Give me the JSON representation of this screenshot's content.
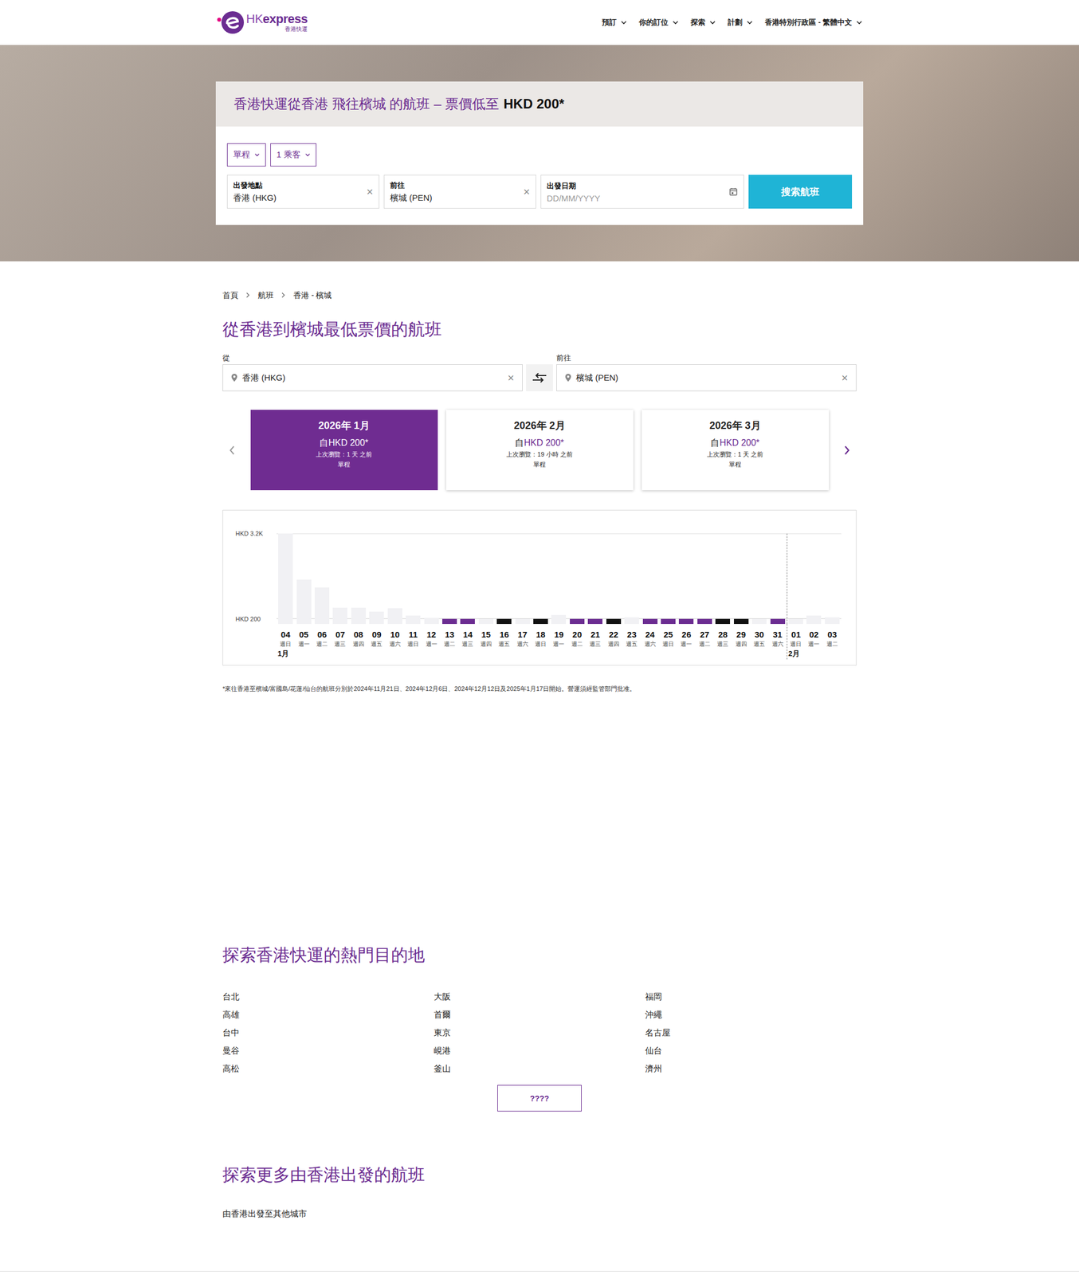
{
  "header": {
    "logo": {
      "prefix": "HK",
      "name": "express",
      "sub": "香港快運"
    },
    "nav": [
      {
        "label": "預訂"
      },
      {
        "label": "你的訂位"
      },
      {
        "label": "探索"
      },
      {
        "label": "計劃"
      },
      {
        "label": "香港特別行政區 - 繁體中文"
      }
    ]
  },
  "hero": {
    "title": "香港快運從香港 飛往檳城 的航班 – 票價低至",
    "title_price": "HKD 200*",
    "trip_type": "單程",
    "passengers": "1 乘客",
    "fields": [
      {
        "kind": "clearable",
        "label": "出發地點",
        "value": "香港 (HKG)",
        "clear": "×"
      },
      {
        "kind": "clearable",
        "label": "前往",
        "value": "檳城 (PEN)",
        "clear": "×"
      },
      {
        "kind": "date",
        "label": "出發日期",
        "placeholder": "DD/MM/YYYY"
      }
    ],
    "search_button": "搜索航班"
  },
  "breadcrumb": [
    "首頁",
    "航班",
    "香港 - 檳城"
  ],
  "route": {
    "heading": "從香港到檳城最低票價的航班",
    "from_label": "從",
    "from": "香港 (HKG)",
    "to_label": "前往",
    "to": "檳城 (PEN)",
    "clear": "×"
  },
  "months": [
    {
      "title": "2026年 1月",
      "prefix": "自",
      "price": "HKD 200*",
      "viewed": "上次瀏覽：1 天 之前",
      "trip": "單程",
      "selected": true
    },
    {
      "title": "2026年 2月",
      "prefix": "自",
      "price": "HKD 200*",
      "viewed": "上次瀏覽：19 小時 之前",
      "trip": "單程",
      "selected": false
    },
    {
      "title": "2026年 3月",
      "prefix": "自",
      "price": "HKD 200*",
      "viewed": "上次瀏覽：1 天 之前",
      "trip": "單程",
      "selected": false
    }
  ],
  "chart": {
    "y_ticks": [
      "HKD 3.2K",
      "HKD 200"
    ],
    "days": [
      {
        "date": "04",
        "weekday": "週日",
        "month": "1月",
        "value": 3200,
        "color": "#f1f1f4"
      },
      {
        "date": "05",
        "weekday": "週一",
        "month": "",
        "value": 1590,
        "color": "#f1f1f4"
      },
      {
        "date": "06",
        "weekday": "週二",
        "month": "",
        "value": 1300,
        "color": "#f1f1f4"
      },
      {
        "date": "07",
        "weekday": "週三",
        "month": "",
        "value": 600,
        "color": "#f1f1f4"
      },
      {
        "date": "08",
        "weekday": "週四",
        "month": "",
        "value": 600,
        "color": "#f1f1f4"
      },
      {
        "date": "09",
        "weekday": "週五",
        "month": "",
        "value": 460,
        "color": "#f1f1f4"
      },
      {
        "date": "10",
        "weekday": "週六",
        "month": "",
        "value": 580,
        "color": "#f1f1f4"
      },
      {
        "date": "11",
        "weekday": "週日",
        "month": "",
        "value": 320,
        "color": "#f1f1f4"
      },
      {
        "date": "12",
        "weekday": "週一",
        "month": "",
        "value": 230,
        "color": "#f1f1f4"
      },
      {
        "date": "13",
        "weekday": "週二",
        "month": "",
        "value": 200,
        "color": "#6b2c91"
      },
      {
        "date": "14",
        "weekday": "週三",
        "month": "",
        "value": 200,
        "color": "#6b2c91"
      },
      {
        "date": "15",
        "weekday": "週四",
        "month": "",
        "value": 200,
        "color": "#f1f1f4"
      },
      {
        "date": "16",
        "weekday": "週五",
        "month": "",
        "value": 200,
        "color": "#111111"
      },
      {
        "date": "17",
        "weekday": "週六",
        "month": "",
        "value": 200,
        "color": "#f1f1f4"
      },
      {
        "date": "18",
        "weekday": "週日",
        "month": "",
        "value": 200,
        "color": "#111111"
      },
      {
        "date": "19",
        "weekday": "週一",
        "month": "",
        "value": 340,
        "color": "#f1f1f4"
      },
      {
        "date": "20",
        "weekday": "週二",
        "month": "",
        "value": 200,
        "color": "#6b2c91"
      },
      {
        "date": "21",
        "weekday": "週三",
        "month": "",
        "value": 200,
        "color": "#6b2c91"
      },
      {
        "date": "22",
        "weekday": "週四",
        "month": "",
        "value": 200,
        "color": "#111111"
      },
      {
        "date": "23",
        "weekday": "週五",
        "month": "",
        "value": 260,
        "color": "#f1f1f4"
      },
      {
        "date": "24",
        "weekday": "週六",
        "month": "",
        "value": 200,
        "color": "#6b2c91"
      },
      {
        "date": "25",
        "weekday": "週日",
        "month": "",
        "value": 200,
        "color": "#6b2c91"
      },
      {
        "date": "26",
        "weekday": "週一",
        "month": "",
        "value": 200,
        "color": "#6b2c91"
      },
      {
        "date": "27",
        "weekday": "週二",
        "month": "",
        "value": 200,
        "color": "#6b2c91"
      },
      {
        "date": "28",
        "weekday": "週三",
        "month": "",
        "value": 200,
        "color": "#111111"
      },
      {
        "date": "29",
        "weekday": "週四",
        "month": "",
        "value": 200,
        "color": "#111111"
      },
      {
        "date": "30",
        "weekday": "週五",
        "month": "",
        "value": 200,
        "color": "#f1f1f4"
      },
      {
        "date": "31",
        "weekday": "週六",
        "month": "",
        "value": 200,
        "color": "#6b2c91"
      },
      {
        "date": "01",
        "weekday": "週日",
        "month": "2月",
        "value": 200,
        "color": "#f1f1f4"
      },
      {
        "date": "02",
        "weekday": "週一",
        "month": "",
        "value": 320,
        "color": "#f1f1f4"
      },
      {
        "date": "03",
        "weekday": "週二",
        "month": "",
        "value": 250,
        "color": "#f1f1f4"
      }
    ]
  },
  "footnote": "*來往香港至檳城/富國島/花蓮/仙台的航班分別於2024年11月21日、2024年12月6日、2024年12月12日及2025年1月17日開始。營運須經監管部門批准。",
  "destinations": {
    "heading": "探索香港快運的熱門目的地",
    "items": [
      "台北",
      "大阪",
      "福岡",
      "高雄",
      "首爾",
      "沖繩",
      "台中",
      "東京",
      "名古屋",
      "曼谷",
      "峴港",
      "仙台",
      "高松",
      "釜山",
      "濟州"
    ],
    "more_button": "????"
  },
  "more": {
    "heading": "探索更多由香港出發的航班",
    "link": "由香港出發至其他城市"
  }
}
